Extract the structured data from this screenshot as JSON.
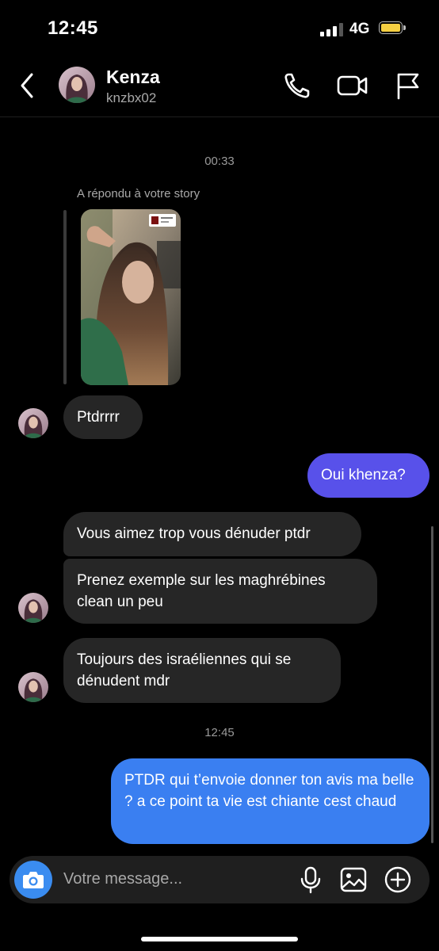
{
  "status_bar": {
    "time": "12:45",
    "network": "4G",
    "battery_color": "#f5cf42"
  },
  "header": {
    "name": "Kenza",
    "username": "knzbx02"
  },
  "chat": {
    "timestamp_1": "00:33",
    "reply_label": "A répondu à votre story",
    "messages": [
      {
        "from": "them",
        "text": "Ptdrrrr"
      },
      {
        "from": "me",
        "text": "Oui khenza?"
      },
      {
        "from": "them",
        "text": "Vous aimez trop vous dénuder ptdr"
      },
      {
        "from": "them",
        "text": "Prenez exemple sur les maghrébines clean un peu"
      },
      {
        "from": "them",
        "text": "Toujours des israéliennes qui se dénudent mdr"
      },
      {
        "from": "me",
        "text": "PTDR qui t’envoie donner ton avis ma belle ? a ce point ta vie est chiante cest chaud"
      }
    ],
    "timestamp_2": "12:45"
  },
  "composer": {
    "placeholder": "Votre message..."
  },
  "colors": {
    "outgoing_purple": "#5851ea",
    "outgoing_blue": "#3a7ff1",
    "incoming": "#262626",
    "camera_button": "#3a8cf0"
  },
  "icons": [
    "back-chevron-icon",
    "phone-icon",
    "video-camera-icon",
    "flag-icon",
    "camera-icon",
    "microphone-icon",
    "gallery-icon",
    "add-circle-icon"
  ]
}
